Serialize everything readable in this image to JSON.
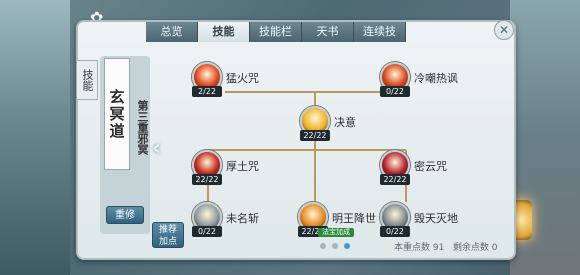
{
  "tabs": [
    "总览",
    "技能",
    "技能栏",
    "天书",
    "连续技"
  ],
  "active_tab": "技能",
  "side_tab": "技能",
  "school": {
    "name": "玄冥道",
    "layer": "第三重邪冥"
  },
  "buttons": {
    "reset": "重修",
    "recommend_line1": "推荐",
    "recommend_line2": "加点"
  },
  "skills": [
    {
      "name": "猛火咒",
      "level": "2/22",
      "color": "#e0451f"
    },
    {
      "name": "冷嘲热讽",
      "level": "0/22",
      "color": "#d8471c"
    },
    {
      "name": "决意",
      "level": "22/22",
      "color": "#f2b52c"
    },
    {
      "name": "厚土咒",
      "level": "22/22",
      "color": "#c2261c"
    },
    {
      "name": "密云咒",
      "level": "22/22",
      "color": "#b31e2c"
    },
    {
      "name": "未名斩",
      "level": "0/22",
      "color": "#8e9aa0"
    },
    {
      "name": "明王降世",
      "level": "22/22",
      "color": "#e58a21",
      "badge": "法宝加成"
    },
    {
      "name": "毁天灭地",
      "level": "0/22",
      "color": "#7f8b90"
    }
  ],
  "footer": {
    "points_label": "本重点数 91",
    "remain_label": "剩余点数 0"
  },
  "page_count": 3,
  "current_page": 3,
  "close_icon": "close-icon"
}
